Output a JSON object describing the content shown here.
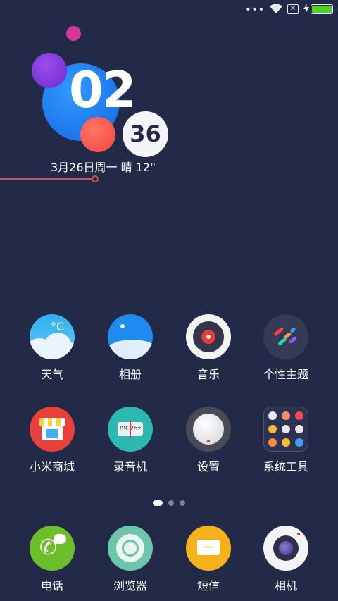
{
  "status_bar": {
    "more": "•••",
    "wifi_icon": "wifi-icon",
    "sim_icon": "no-sim-icon",
    "charging_icon": "charging-bolt-icon",
    "battery_level": 1.0
  },
  "clock": {
    "hour": "02",
    "minute": "36",
    "date": "3月26日周一  晴 12°"
  },
  "apps": [
    {
      "label": "天气",
      "icon": "weather-icon"
    },
    {
      "label": "相册",
      "icon": "gallery-icon"
    },
    {
      "label": "音乐",
      "icon": "music-icon"
    },
    {
      "label": "个性主题",
      "icon": "themes-icon"
    },
    {
      "label": "小米商城",
      "icon": "store-icon"
    },
    {
      "label": "录音机",
      "icon": "recorder-icon",
      "icon_text": "89.2hz"
    },
    {
      "label": "设置",
      "icon": "settings-icon"
    },
    {
      "label": "系统工具",
      "icon": "tools-folder-icon"
    }
  ],
  "pager": {
    "pages": 3,
    "current": 1
  },
  "dock": [
    {
      "label": "电话",
      "icon": "phone-icon"
    },
    {
      "label": "浏览器",
      "icon": "browser-icon"
    },
    {
      "label": "短信",
      "icon": "messages-icon",
      "icon_text": "---"
    },
    {
      "label": "相机",
      "icon": "camera-icon"
    }
  ],
  "colors": {
    "background": "#222a48",
    "accent_line": "#e24a4a",
    "battery": "#4fd31f"
  }
}
